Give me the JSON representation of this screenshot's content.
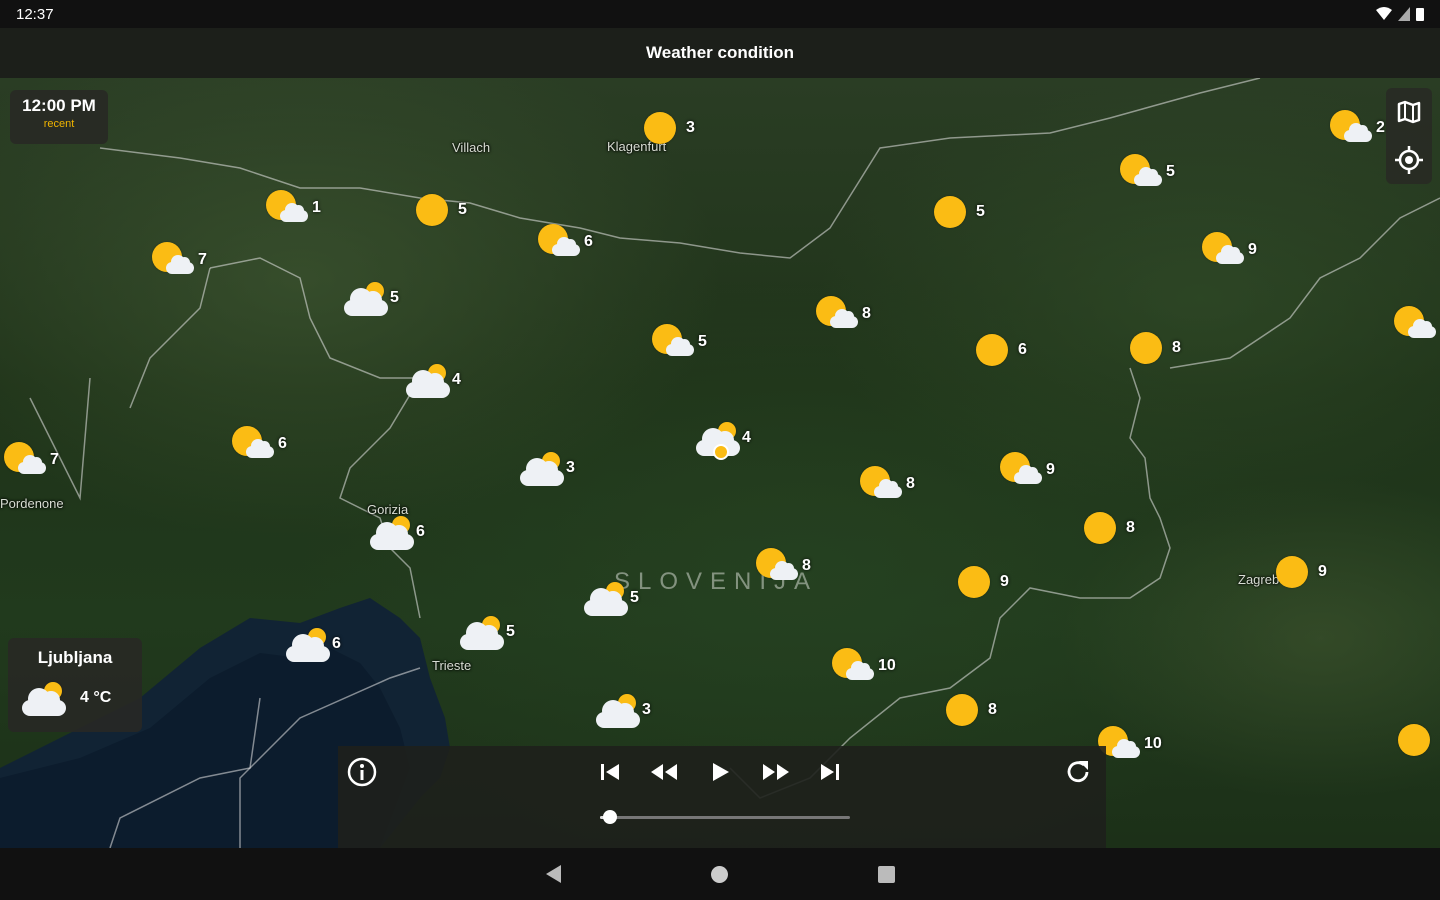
{
  "status": {
    "time": "12:37"
  },
  "header": {
    "title": "Weather condition"
  },
  "map": {
    "time_card": {
      "time": "12:00 PM",
      "label": "recent"
    },
    "places": [
      {
        "name": "Villach"
      },
      {
        "name": "Klagenfurt"
      },
      {
        "name": "Pordenone"
      },
      {
        "name": "Gorizia"
      },
      {
        "name": "Trieste"
      },
      {
        "name": "Zagreb"
      }
    ],
    "country": "SLOVENIJA",
    "stations": [
      {
        "icon": "sun",
        "temp": "3"
      },
      {
        "icon": "sun-cloud",
        "temp": "1"
      },
      {
        "icon": "sun",
        "temp": "5"
      },
      {
        "icon": "sun-cloud",
        "temp": "6"
      },
      {
        "icon": "sun",
        "temp": "5"
      },
      {
        "icon": "sun-cloud",
        "temp": "5"
      },
      {
        "icon": "sun-cloud",
        "temp": "2"
      },
      {
        "icon": "sun-cloud",
        "temp": "7"
      },
      {
        "icon": "sun-cloud",
        "temp": "9"
      },
      {
        "icon": "cloud-sun",
        "temp": "5"
      },
      {
        "icon": "sun-cloud",
        "temp": "5"
      },
      {
        "icon": "sun-cloud",
        "temp": "8"
      },
      {
        "icon": "sun",
        "temp": "6"
      },
      {
        "icon": "sun",
        "temp": "8"
      },
      {
        "icon": "sun-cloud",
        "temp": ""
      },
      {
        "icon": "cloud-sun",
        "temp": "4"
      },
      {
        "icon": "sun-cloud",
        "temp": "6"
      },
      {
        "icon": "sun-cloud",
        "temp": "7"
      },
      {
        "icon": "cloud-sun",
        "temp": "4"
      },
      {
        "icon": "cloud-sun",
        "temp": "3"
      },
      {
        "icon": "sun-cloud",
        "temp": "8"
      },
      {
        "icon": "sun-cloud",
        "temp": "9"
      },
      {
        "icon": "sun",
        "temp": "8"
      },
      {
        "icon": "cloud-sun",
        "temp": "6"
      },
      {
        "icon": "sun-cloud",
        "temp": "8"
      },
      {
        "icon": "sun",
        "temp": "9"
      },
      {
        "icon": "sun",
        "temp": "9"
      },
      {
        "icon": "cloud-sun",
        "temp": "5"
      },
      {
        "icon": "cloud-sun",
        "temp": "5"
      },
      {
        "icon": "cloud-sun",
        "temp": "6"
      },
      {
        "icon": "sun-cloud",
        "temp": "10"
      },
      {
        "icon": "cloud-sun",
        "temp": "3"
      },
      {
        "icon": "sun",
        "temp": "8"
      },
      {
        "icon": "sun-cloud",
        "temp": "10"
      },
      {
        "icon": "sun",
        "temp": ""
      }
    ],
    "city_card": {
      "name": "Ljubljana",
      "icon": "cloud-sun",
      "temp": "4 °C"
    }
  },
  "player": {
    "progress": 0.04
  },
  "icons": {
    "sun": "sun-icon",
    "sun-cloud": "sun-behind-cloud-icon",
    "cloud-sun": "cloud-with-sun-icon",
    "layers": "map-layers-icon",
    "locate": "my-location-icon",
    "info": "info-icon",
    "refresh": "refresh-icon"
  },
  "colors": {
    "sun": "#fbbc14",
    "accent": "#f0b400",
    "panel": "#282824"
  }
}
